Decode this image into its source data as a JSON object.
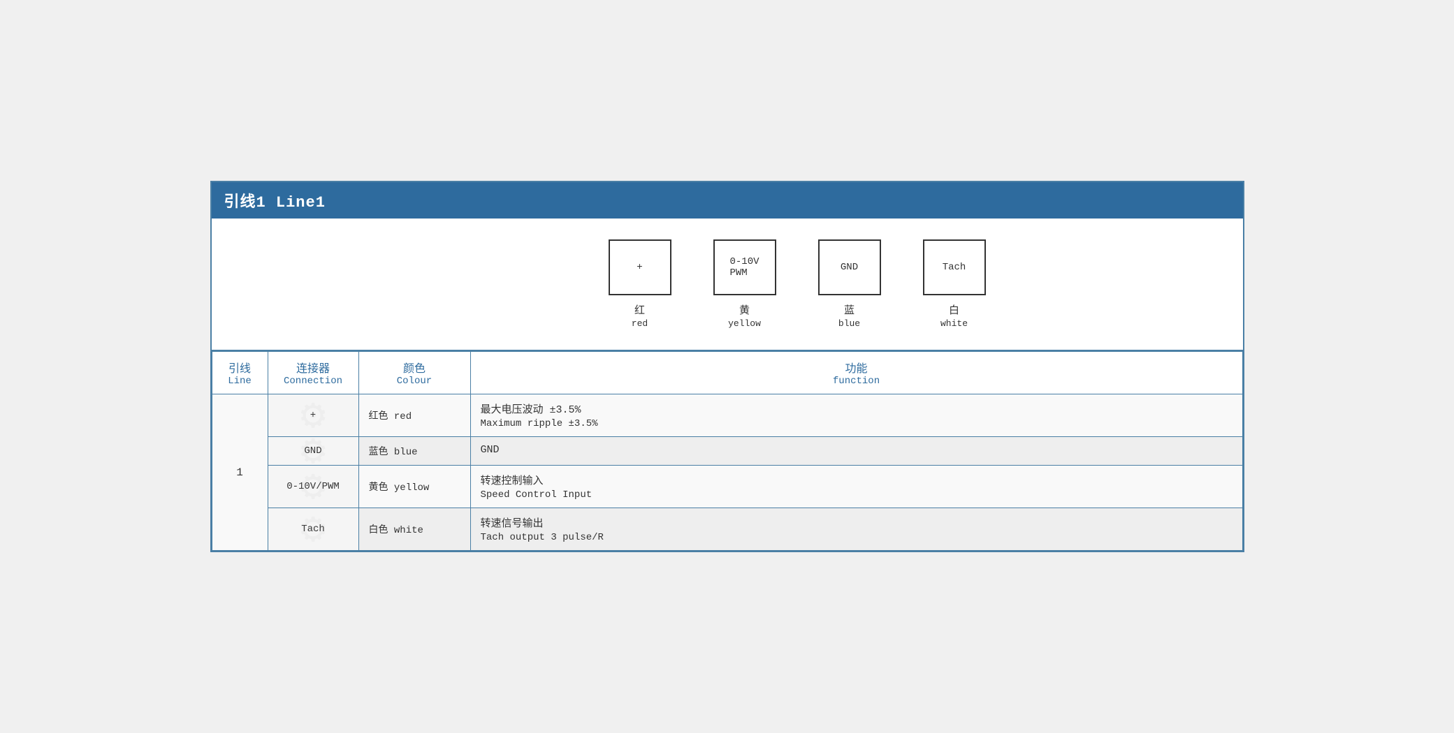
{
  "header": {
    "title": "引线1 Line1"
  },
  "diagram": {
    "connectors": [
      {
        "symbol": "+",
        "label_cn": "红",
        "label_en": "red"
      },
      {
        "symbol": "0-10V\nPWM",
        "label_cn": "黄",
        "label_en": "yellow"
      },
      {
        "symbol": "GND",
        "label_cn": "蓝",
        "label_en": "blue"
      },
      {
        "symbol": "Tach",
        "label_cn": "白",
        "label_en": "white"
      }
    ]
  },
  "table": {
    "headers": [
      {
        "cn": "引线",
        "en": "Line"
      },
      {
        "cn": "连接器",
        "en": "Connection"
      },
      {
        "cn": "颜色",
        "en": "Colour"
      },
      {
        "cn": "功能",
        "en": "function"
      }
    ],
    "rows": [
      {
        "line": "1",
        "connection": "+",
        "colour_cn": "红色",
        "colour_en": "red",
        "function_cn": "最大电压波动 ±3.5%",
        "function_en": "Maximum ripple ±3.5%",
        "rowspan": 4
      },
      {
        "line": "",
        "connection": "GND",
        "colour_cn": "蓝色",
        "colour_en": "blue",
        "function_cn": "GND",
        "function_en": ""
      },
      {
        "line": "",
        "connection": "0-10V/PWM",
        "colour_cn": "黄色",
        "colour_en": "yellow",
        "function_cn": "转速控制输入",
        "function_en": "Speed Control Input"
      },
      {
        "line": "",
        "connection": "Tach",
        "colour_cn": "白色",
        "colour_en": "white",
        "function_cn": "转速信号输出",
        "function_en": "Tach output 3 pulse/R"
      }
    ]
  }
}
